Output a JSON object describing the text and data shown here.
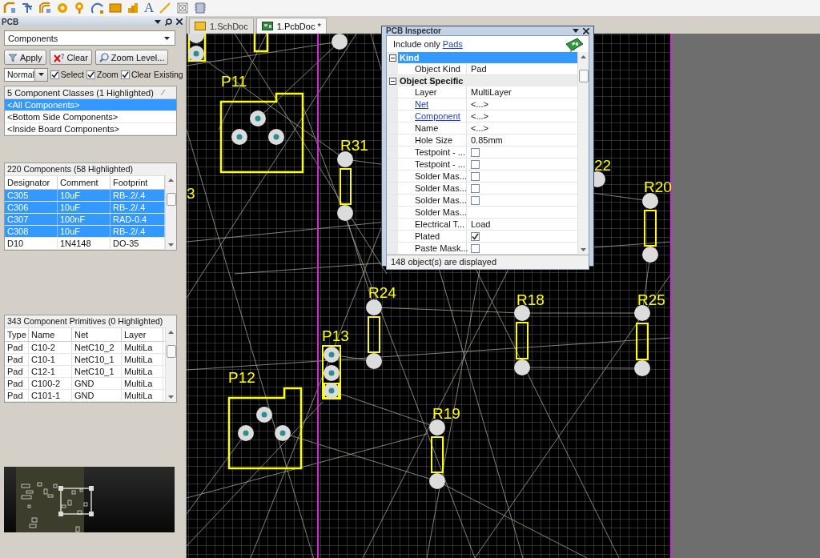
{
  "toolbar": [
    {
      "kind": "route"
    },
    {
      "kind": "branch"
    },
    {
      "kind": "pair"
    },
    {
      "kind": "pad"
    },
    {
      "kind": "via"
    },
    {
      "kind": "arc"
    },
    {
      "kind": "fill"
    },
    {
      "kind": "bars"
    },
    {
      "kind": "glyph",
      "text": "A"
    },
    {
      "kind": "line"
    },
    {
      "kind": "crossed"
    },
    {
      "kind": "chip"
    }
  ],
  "panel": {
    "title": "PCB",
    "mode": "Components",
    "buttons": [
      {
        "kind": "filter",
        "label": "Apply"
      },
      {
        "kind": "clear",
        "label": "Clear"
      },
      {
        "kind": "zoom",
        "label": "Zoom Level..."
      }
    ],
    "filter_mode": "Normal",
    "options": [
      {
        "label": "Select",
        "checked": true
      },
      {
        "label": "Zoom",
        "checked": true
      },
      {
        "label": "Clear Existing",
        "checked": true
      }
    ],
    "classes": {
      "header": "5 Component Classes (1 Highlighted)",
      "rows": [
        {
          "label": "<All Components>",
          "selected": true
        },
        {
          "label": "<Bottom Side Components>",
          "selected": false
        },
        {
          "label": "<Inside Board Components>",
          "selected": false
        }
      ]
    },
    "components": {
      "header": "220 Components (58 Highlighted)",
      "columns": [
        "Designator",
        "Comment",
        "Footprint"
      ],
      "rows": [
        {
          "cells": [
            "C305",
            "10uF",
            "RB-.2/.4"
          ],
          "selected": true
        },
        {
          "cells": [
            "C306",
            "10uF",
            "RB-.2/.4"
          ],
          "selected": true
        },
        {
          "cells": [
            "C307",
            "100nF",
            "RAD-0.4"
          ],
          "selected": true
        },
        {
          "cells": [
            "C308",
            "10uF",
            "RB-.2/.4"
          ],
          "selected": true
        },
        {
          "cells": [
            "D10",
            "1N4148",
            "DO-35"
          ],
          "selected": false
        }
      ]
    },
    "primitives": {
      "header": "343 Component Primitives (0 Highlighted)",
      "columns": [
        "Type",
        "Name",
        "Net",
        "Layer"
      ],
      "rows": [
        {
          "cells": [
            "Pad",
            "C10-2",
            "NetC10_2",
            "MultiLa"
          ],
          "selected": false
        },
        {
          "cells": [
            "Pad",
            "C10-1",
            "NetC10_1",
            "MultiLa"
          ],
          "selected": false
        },
        {
          "cells": [
            "Pad",
            "C12-1",
            "NetC10_1",
            "MultiLa"
          ],
          "selected": false
        },
        {
          "cells": [
            "Pad",
            "C100-2",
            "GND",
            "MultiLa"
          ],
          "selected": false
        },
        {
          "cells": [
            "Pad",
            "C101-1",
            "GND",
            "MultiLa"
          ],
          "selected": false
        }
      ]
    }
  },
  "tabs": [
    {
      "kind": "schematic",
      "label": "1.SchDoc",
      "selected": false
    },
    {
      "kind": "pcb",
      "label": "1.PcbDoc *",
      "selected": true
    }
  ],
  "canvas": {
    "labels": [
      "P11",
      "R31",
      "3",
      "22",
      "R20",
      "R24",
      "R18",
      "R25",
      "P13",
      "P12",
      "R19"
    ]
  },
  "inspector": {
    "title": "PCB Inspector",
    "filter_label": "Include only",
    "filter_link": "Pads",
    "sections": [
      {
        "title": "Kind",
        "selected": true,
        "expanded": true,
        "rows": [
          {
            "kind": "text",
            "name": "Object Kind",
            "value": "Pad"
          }
        ]
      },
      {
        "title": "Object Specific",
        "selected": false,
        "expanded": true,
        "rows": [
          {
            "kind": "text",
            "name": "Layer",
            "value": "MultiLayer"
          },
          {
            "kind": "link",
            "name": "Net",
            "value": "<...>"
          },
          {
            "kind": "link",
            "name": "Component",
            "value": "<...>"
          },
          {
            "kind": "text",
            "name": "Name",
            "value": "<...>"
          },
          {
            "kind": "text",
            "name": "Hole Size",
            "value": "0.85mm"
          },
          {
            "kind": "checkbox",
            "name": "Testpoint - ...",
            "checked": false
          },
          {
            "kind": "checkbox",
            "name": "Testpoint - ...",
            "checked": false
          },
          {
            "kind": "checkbox",
            "name": "Solder Mas...",
            "checked": false
          },
          {
            "kind": "checkbox",
            "name": "Solder Mas...",
            "checked": false
          },
          {
            "kind": "checkbox",
            "name": "Solder Mas...",
            "checked": false
          },
          {
            "kind": "text",
            "name": "Solder Mas..."
          },
          {
            "kind": "text",
            "name": "Electrical T...",
            "value": "Load"
          },
          {
            "kind": "checkbox",
            "name": "Plated",
            "checked": true
          },
          {
            "kind": "checkbox",
            "name": "Paste Mask...",
            "checked": false
          }
        ]
      }
    ],
    "status": "148 object(s) are displayed"
  }
}
